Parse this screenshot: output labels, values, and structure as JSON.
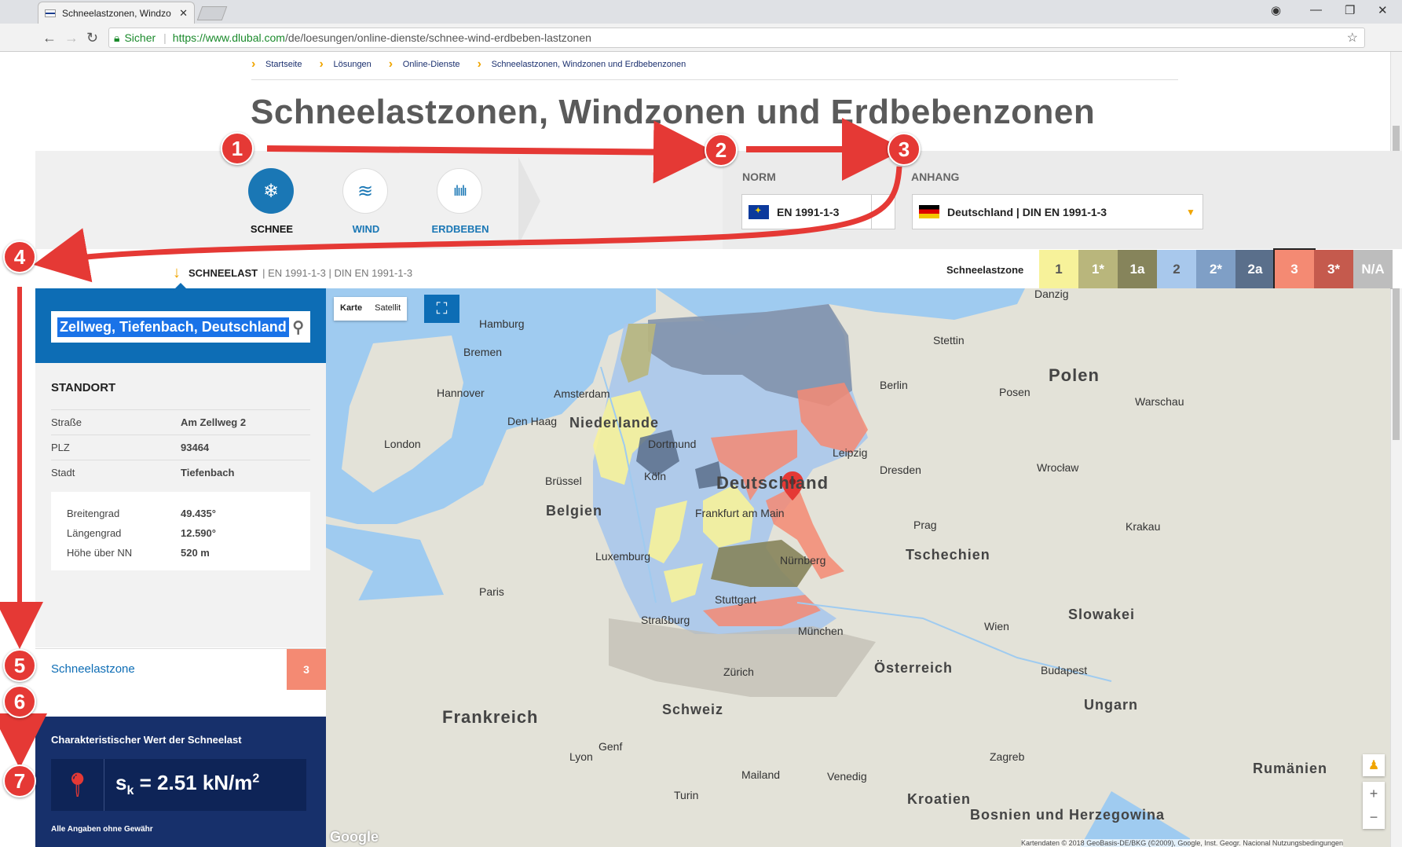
{
  "browser": {
    "tab_title": "Schneelastzonen, Windzo",
    "secure_label": "Sicher",
    "url_host": "https://www.dlubal.com",
    "url_path": "/de/loesungen/online-dienste/schnee-wind-erdbeben-lastzonen"
  },
  "breadcrumb": [
    "Startseite",
    "Lösungen",
    "Online-Dienste",
    "Schneelastzonen, Windzonen und Erdbebenzonen"
  ],
  "page_title": "Schneelastzonen, Windzonen und Erdbebenzonen",
  "categories": [
    {
      "label": "SCHNEE",
      "icon": "snowflake-icon",
      "active": true
    },
    {
      "label": "WIND",
      "icon": "wind-icon",
      "active": false
    },
    {
      "label": "ERDBEBEN",
      "icon": "seismic-wave-icon",
      "active": false
    }
  ],
  "norm": {
    "label": "NORM",
    "value": "EN 1991-1-3"
  },
  "anhang": {
    "label": "ANHANG",
    "value": "Deutschland | DIN EN 1991-1-3"
  },
  "load_bar": {
    "main": "SCHNEELAST",
    "sub1": "EN 1991-1-3",
    "sub2": "DIN EN 1991-1-3",
    "zone_label": "Schneelastzone"
  },
  "zones": [
    {
      "label": "1",
      "color": "#f7f29a",
      "text": "#555"
    },
    {
      "label": "1*",
      "color": "#b9b67c",
      "text": "#fff"
    },
    {
      "label": "1a",
      "color": "#86845b",
      "text": "#fff"
    },
    {
      "label": "2",
      "color": "#a8c8ec",
      "text": "#555"
    },
    {
      "label": "2*",
      "color": "#7f9fc6",
      "text": "#fff"
    },
    {
      "label": "2a",
      "color": "#5a6f8b",
      "text": "#fff"
    },
    {
      "label": "3",
      "color": "#f48a73",
      "text": "#fff"
    },
    {
      "label": "3*",
      "color": "#c55a4d",
      "text": "#fff"
    },
    {
      "label": "N/A",
      "color": "#bdbdbd",
      "text": "#fff"
    }
  ],
  "search": {
    "value": "Zellweg, Tiefenbach, Deutschland"
  },
  "standort": {
    "title": "STANDORT",
    "rows": [
      {
        "k": "Straße",
        "v": "Am Zellweg 2"
      },
      {
        "k": "PLZ",
        "v": "93464"
      },
      {
        "k": "Stadt",
        "v": "Tiefenbach"
      }
    ],
    "coords": [
      {
        "k": "Breitengrad",
        "v": "49.435°"
      },
      {
        "k": "Längengrad",
        "v": "12.590°"
      },
      {
        "k": "Höhe über NN",
        "v": "520 m"
      }
    ]
  },
  "zone_result": {
    "label": "Schneelastzone",
    "value": "3"
  },
  "characteristic": {
    "title": "Charakteristischer Wert der Schneelast",
    "value": "sk = 2.51 kN/m2",
    "note": "Alle Angaben ohne Gewähr"
  },
  "map": {
    "type_karte": "Karte",
    "type_satellit": "Satellit",
    "google": "Google",
    "attribution": "Kartendaten © 2018 GeoBasis-DE/BKG (©2009), Google, Inst. Geogr. Nacional   Nutzungsbedingungen",
    "labels": [
      {
        "text": "Hamburg"
      },
      {
        "text": "Bremen"
      },
      {
        "text": "Berlin"
      },
      {
        "text": "Hannover"
      },
      {
        "text": "Leipzig"
      },
      {
        "text": "Dresden"
      },
      {
        "text": "Dortmund"
      },
      {
        "text": "Köln"
      },
      {
        "text": "Frankfurt am Main"
      },
      {
        "text": "Nürnberg"
      },
      {
        "text": "Stuttgart"
      },
      {
        "text": "München"
      },
      {
        "text": "Deutschland"
      },
      {
        "text": "Niederlande"
      },
      {
        "text": "Belgien"
      },
      {
        "text": "Polen"
      },
      {
        "text": "Tschechien"
      },
      {
        "text": "Frankreich"
      },
      {
        "text": "Schweiz"
      },
      {
        "text": "Österreich"
      },
      {
        "text": "Slowakei"
      },
      {
        "text": "Ungarn"
      },
      {
        "text": "Rumänien"
      },
      {
        "text": "Kroatien"
      },
      {
        "text": "Bosnien und Herzegowina"
      },
      {
        "text": "Amsterdam"
      },
      {
        "text": "Den Haag"
      },
      {
        "text": "Brüssel"
      },
      {
        "text": "Paris"
      },
      {
        "text": "London"
      },
      {
        "text": "Prag"
      },
      {
        "text": "Wien"
      },
      {
        "text": "Warschau"
      },
      {
        "text": "Stettin"
      },
      {
        "text": "Posen"
      },
      {
        "text": "Wrocław"
      },
      {
        "text": "Krakau"
      },
      {
        "text": "Budapest"
      },
      {
        "text": "Zürich"
      },
      {
        "text": "Lyon"
      },
      {
        "text": "Venedig"
      },
      {
        "text": "Zagreb"
      },
      {
        "text": "Danzig"
      },
      {
        "text": "Luxemburg"
      },
      {
        "text": "Straßburg"
      },
      {
        "text": "Mailand"
      },
      {
        "text": "Turin"
      },
      {
        "text": "Genf"
      }
    ]
  },
  "annotations": [
    "1",
    "2",
    "3",
    "4",
    "5",
    "6",
    "7"
  ]
}
